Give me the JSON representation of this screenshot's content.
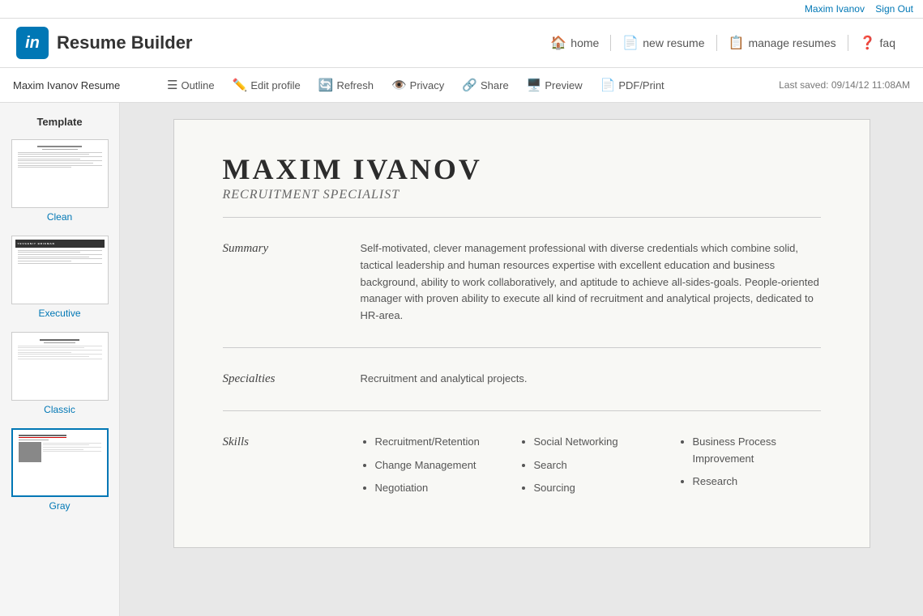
{
  "topbar": {
    "user": "Maxim Ivanov",
    "signout": "Sign Out"
  },
  "header": {
    "logo_text": "in",
    "app_title": "Resume Builder",
    "nav": [
      {
        "id": "home",
        "icon": "🏠",
        "label": "home"
      },
      {
        "id": "new-resume",
        "icon": "📄",
        "label": "new resume"
      },
      {
        "id": "manage-resumes",
        "icon": "📋",
        "label": "manage resumes"
      },
      {
        "id": "faq",
        "icon": "❓",
        "label": "faq"
      }
    ]
  },
  "toolbar": {
    "resume_name": "Maxim Ivanov Resume",
    "buttons": [
      {
        "id": "outline",
        "icon": "☰",
        "label": "Outline"
      },
      {
        "id": "edit-profile",
        "icon": "✏️",
        "label": "Edit profile"
      },
      {
        "id": "refresh",
        "icon": "🔄",
        "label": "Refresh"
      },
      {
        "id": "privacy",
        "icon": "👁️",
        "label": "Privacy"
      },
      {
        "id": "share",
        "icon": "🔗",
        "label": "Share"
      },
      {
        "id": "preview",
        "icon": "🖥️",
        "label": "Preview"
      },
      {
        "id": "pdf-print",
        "icon": "📄",
        "label": "PDF/Print"
      }
    ],
    "last_saved": "Last saved: 09/14/12 11:08AM"
  },
  "sidebar": {
    "title": "Template",
    "templates": [
      {
        "id": "clean",
        "label": "Clean",
        "selected": false
      },
      {
        "id": "executive",
        "label": "Executive",
        "selected": false
      },
      {
        "id": "classic",
        "label": "Classic",
        "selected": false
      },
      {
        "id": "gray",
        "label": "Gray",
        "selected": true
      }
    ]
  },
  "resume": {
    "name": "MAXIM IVANOV",
    "title": "RECRUITMENT SPECIALIST",
    "sections": [
      {
        "id": "summary",
        "label": "Summary",
        "content": "Self-motivated, clever management professional with diverse credentials which combine solid, tactical leadership and human resources expertise with excellent education and business background, ability to work collaboratively, and aptitude to achieve all-sides-goals. People-oriented manager with proven ability to execute all kind of recruitment and analytical projects, dedicated to HR-area."
      },
      {
        "id": "specialties",
        "label": "Specialties",
        "content": "Recruitment and analytical projects."
      },
      {
        "id": "skills",
        "label": "Skills",
        "columns": [
          [
            "Recruitment/Retention",
            "Change Management",
            "Negotiation"
          ],
          [
            "Social Networking",
            "Search",
            "Sourcing"
          ],
          [
            "Business Process Improvement",
            "Research"
          ]
        ]
      }
    ]
  }
}
